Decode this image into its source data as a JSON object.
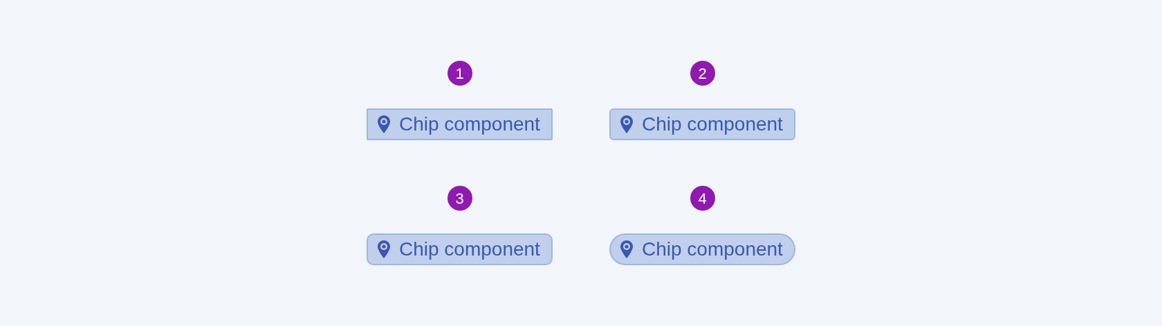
{
  "examples": [
    {
      "number": "1",
      "label": "Chip component",
      "kind": "square"
    },
    {
      "number": "2",
      "label": "Chip component",
      "kind": "rounded"
    },
    {
      "number": "3",
      "label": "Chip component",
      "kind": "roundish"
    },
    {
      "number": "4",
      "label": "Chip component",
      "kind": "pill"
    }
  ]
}
